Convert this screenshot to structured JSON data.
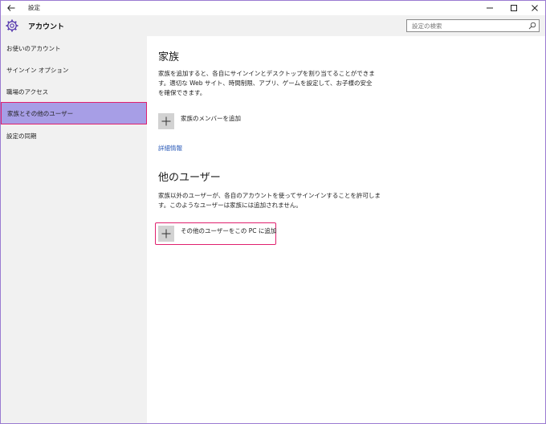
{
  "titlebar": {
    "title": "設定"
  },
  "header": {
    "section": "アカウント"
  },
  "search": {
    "placeholder": "設定の検索"
  },
  "sidebar": {
    "items": [
      {
        "label": "お使いのアカウント"
      },
      {
        "label": "サインイン オプション"
      },
      {
        "label": "職場のアクセス"
      },
      {
        "label": "家族とその他のユーザー",
        "selected": true
      },
      {
        "label": "設定の同期"
      }
    ]
  },
  "family": {
    "title": "家族",
    "desc_line1": "家族を追加すると、各自にサインインとデスクトップを割り当てることができま",
    "desc_line2": "す。適切な Web サイト、時間制限、アプリ、ゲームを設定して、お子様の安全",
    "desc_line3": "を確保できます。",
    "add_label": "家族のメンバーを追加",
    "link_label": "詳細情報"
  },
  "others": {
    "title": "他のユーザー",
    "desc_line1": "家族以外のユーザーが、各自のアカウントを使ってサインインすることを許可しま",
    "desc_line2": "す。このようなユーザーは家族には追加されません。",
    "add_label": "その他のユーザーをこの PC に追加"
  },
  "colors": {
    "accent": "#a79ee6",
    "highlight": "#e0206e",
    "link": "#2a5ab8"
  }
}
